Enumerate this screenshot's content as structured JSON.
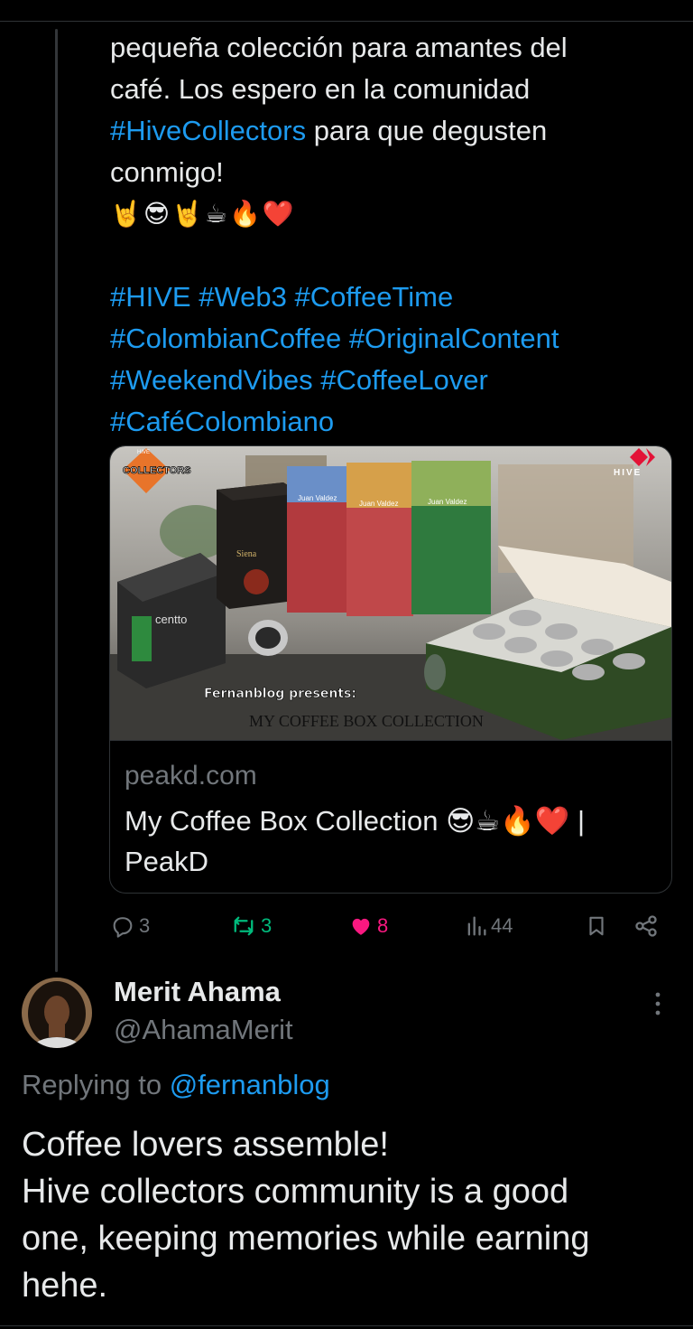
{
  "tweet": {
    "lines": [
      "pequeña colección para amantes del",
      "café. Los espero en la comunidad"
    ],
    "hashtag_inline": "#HiveCollectors",
    "line3_rest": " para que degusten",
    "line4": "conmigo!",
    "emoji_line": "🤘😎🤘☕🔥❤️",
    "hashtags": [
      "#HIVE #Web3 #CoffeeTime",
      "#ColombianCoffee #OriginalContent",
      "#WeekendVibes #CoffeeLover",
      "#CaféColombiano"
    ]
  },
  "card": {
    "badge_left_top": "HIVE",
    "badge_left": "COLLECTORS",
    "badge_right": "HIVE",
    "overlay_line1": "Fernanblog presents:",
    "overlay_line2": "MY COFFEE BOX COLLECTION",
    "box_labels": [
      "centto",
      "Juan Valdez",
      "Juan Valdez",
      "Juan Valdez",
      "Siena"
    ],
    "domain": "peakd.com",
    "title_line1": "My Coffee Box Collection 😎☕🔥❤️ |",
    "title_line2": "PeakD"
  },
  "actions": {
    "replies": "3",
    "reposts": "3",
    "likes": "8",
    "views": "44",
    "colors": {
      "muted": "#71767b",
      "repost": "#00ba7c",
      "like": "#f91880",
      "link": "#1d9bf0"
    }
  },
  "reply": {
    "name": "Merit Ahama",
    "handle": "@AhamaMerit",
    "replying_prefix": "Replying to ",
    "replying_to": "@fernanblog",
    "text_lines": [
      "Coffee lovers assemble!",
      "Hive collectors community is a good",
      "one, keeping memories while earning",
      "hehe."
    ]
  },
  "icons": [
    "reply-icon",
    "repost-icon",
    "like-icon",
    "views-icon",
    "bookmark-icon",
    "share-icon",
    "more-icon"
  ]
}
